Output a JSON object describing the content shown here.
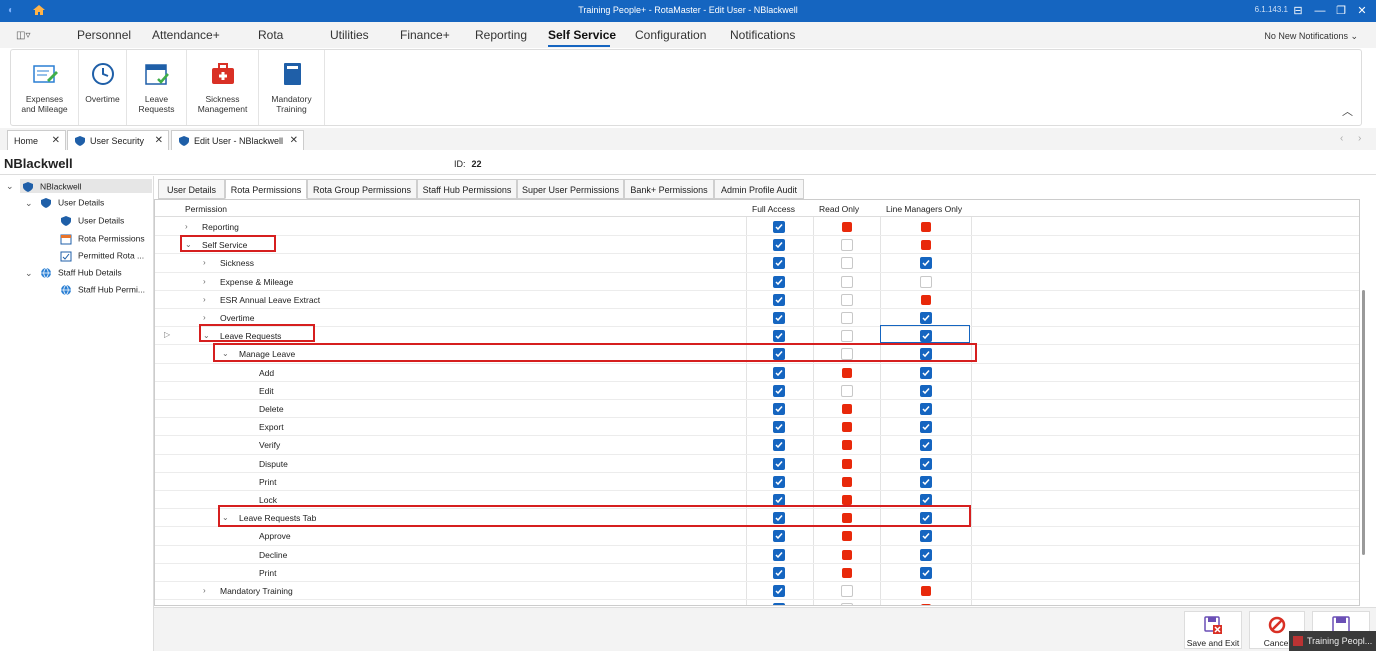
{
  "window": {
    "title": "Training People+ - RotaMaster - Edit User - NBlackwell",
    "version": "6.1.143.1"
  },
  "menu": {
    "items": [
      "Personnel",
      "Attendance+",
      "Rota",
      "Utilities",
      "Finance+",
      "Reporting",
      "Self Service",
      "Configuration",
      "Notifications"
    ],
    "active": "Self Service",
    "notifications": "No New Notifications"
  },
  "ribbon": {
    "buttons": [
      {
        "label1": "Expenses",
        "label2": "and Mileage",
        "icon": "expenses-icon"
      },
      {
        "label1": "Overtime",
        "label2": "",
        "icon": "clock-icon"
      },
      {
        "label1": "Leave",
        "label2": "Requests",
        "icon": "calendar-check-icon"
      },
      {
        "label1": "Sickness",
        "label2": "Management",
        "icon": "medical-kit-icon"
      },
      {
        "label1": "Mandatory",
        "label2": "Training",
        "icon": "book-icon"
      }
    ]
  },
  "doc_tabs": [
    "Home",
    "User Security",
    "Edit User - NBlackwell"
  ],
  "header": {
    "username": "NBlackwell",
    "id_label": "ID:",
    "id_value": "22"
  },
  "tree": {
    "root": "NBlackwell",
    "user_details": "User Details",
    "user_details_child": "User Details",
    "rota_permissions": "Rota Permissions",
    "permitted_rota": "Permitted Rota ...",
    "staff_hub_details": "Staff Hub Details",
    "staff_hub_perm": "Staff Hub Permi..."
  },
  "perm_tabs": [
    "User Details",
    "Rota Permissions",
    "Rota Group Permissions",
    "Staff Hub Permissions",
    "Super User Permissions",
    "Bank+ Permissions",
    "Admin Profile Audit"
  ],
  "active_perm_tab": "Rota Permissions",
  "grid": {
    "columns": {
      "permission": "Permission",
      "full": "Full Access",
      "read": "Read Only",
      "line": "Line Managers Only"
    },
    "rows": [
      {
        "label": "Reporting",
        "level": 0,
        "exp": ">",
        "full": "on",
        "read": "red",
        "line": "red"
      },
      {
        "label": "Self Service",
        "level": 0,
        "exp": "v",
        "full": "on",
        "read": "off",
        "line": "red"
      },
      {
        "label": "Sickness",
        "level": 1,
        "exp": ">",
        "full": "on",
        "read": "off",
        "line": "on"
      },
      {
        "label": "Expense & Mileage",
        "level": 1,
        "exp": ">",
        "full": "on",
        "read": "off",
        "line": "off"
      },
      {
        "label": "ESR Annual Leave Extract",
        "level": 1,
        "exp": ">",
        "full": "on",
        "read": "off",
        "line": "red"
      },
      {
        "label": "Overtime",
        "level": 1,
        "exp": ">",
        "full": "on",
        "read": "off",
        "line": "on"
      },
      {
        "label": "Leave Requests",
        "level": 1,
        "exp": "v",
        "full": "on",
        "read": "off",
        "line": "on"
      },
      {
        "label": "Manage Leave",
        "level": 2,
        "exp": "v",
        "full": "on",
        "read": "off",
        "line": "on"
      },
      {
        "label": "Add",
        "level": 3,
        "exp": "",
        "full": "on",
        "read": "red",
        "line": "on"
      },
      {
        "label": "Edit",
        "level": 3,
        "exp": "",
        "full": "on",
        "read": "off",
        "line": "on"
      },
      {
        "label": "Delete",
        "level": 3,
        "exp": "",
        "full": "on",
        "read": "red",
        "line": "on"
      },
      {
        "label": "Export",
        "level": 3,
        "exp": "",
        "full": "on",
        "read": "red",
        "line": "on"
      },
      {
        "label": "Verify",
        "level": 3,
        "exp": "",
        "full": "on",
        "read": "red",
        "line": "on"
      },
      {
        "label": "Dispute",
        "level": 3,
        "exp": "",
        "full": "on",
        "read": "red",
        "line": "on"
      },
      {
        "label": "Print",
        "level": 3,
        "exp": "",
        "full": "on",
        "read": "red",
        "line": "on"
      },
      {
        "label": "Lock",
        "level": 3,
        "exp": "",
        "full": "on",
        "read": "red",
        "line": "on"
      },
      {
        "label": "Leave Requests Tab",
        "level": 2,
        "exp": "v",
        "full": "on",
        "read": "red",
        "line": "on"
      },
      {
        "label": "Approve",
        "level": 3,
        "exp": "",
        "full": "on",
        "read": "red",
        "line": "on"
      },
      {
        "label": "Decline",
        "level": 3,
        "exp": "",
        "full": "on",
        "read": "red",
        "line": "on"
      },
      {
        "label": "Print",
        "level": 3,
        "exp": "",
        "full": "on",
        "read": "red",
        "line": "on"
      },
      {
        "label": "Mandatory Training",
        "level": 1,
        "exp": ">",
        "full": "on",
        "read": "off",
        "line": "red"
      },
      {
        "label": "Configuration",
        "level": 0,
        "exp": ">",
        "full": "on",
        "read": "off",
        "line": "red"
      }
    ]
  },
  "footer": {
    "save_exit": "Save and Exit",
    "cancel": "Cancel"
  },
  "taskbar_popup": "Training Peopl...",
  "colors": {
    "accent": "#1565c0",
    "highlight": "#d61f1f",
    "red_square": "#e8290b"
  }
}
